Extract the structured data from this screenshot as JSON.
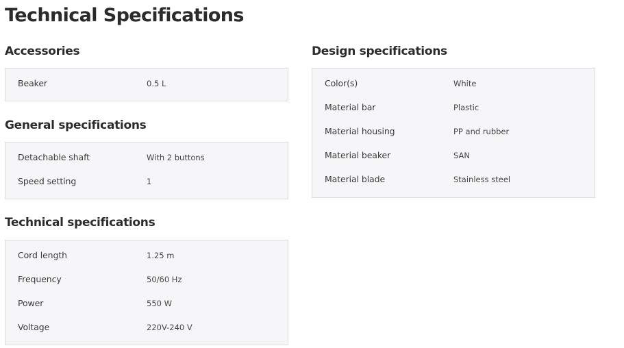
{
  "page": {
    "title": "Technical Specifications"
  },
  "sections": {
    "accessories": {
      "title": "Accessories",
      "rows": [
        {
          "label": "Beaker",
          "value": "0.5 L"
        }
      ]
    },
    "general": {
      "title": "General specifications",
      "rows": [
        {
          "label": "Detachable shaft",
          "value": "With 2 buttons"
        },
        {
          "label": "Speed setting",
          "value": "1"
        }
      ]
    },
    "technical": {
      "title": "Technical specifications",
      "rows": [
        {
          "label": "Cord length",
          "value": "1.25  m"
        },
        {
          "label": "Frequency",
          "value": "50/60  Hz"
        },
        {
          "label": "Power",
          "value": "550  W"
        },
        {
          "label": "Voltage",
          "value": "220V-240  V"
        }
      ]
    },
    "design": {
      "title": "Design specifications",
      "rows": [
        {
          "label": "Color(s)",
          "value": "White"
        },
        {
          "label": "Material bar",
          "value": "Plastic"
        },
        {
          "label": "Material housing",
          "value": "PP and rubber"
        },
        {
          "label": "Material beaker",
          "value": "SAN"
        },
        {
          "label": "Material blade",
          "value": "Stainless steel"
        }
      ]
    }
  },
  "colors": {
    "text": "#2b2b2b",
    "table_background": "#f6f6f8",
    "table_border": "#dcdcdf"
  }
}
